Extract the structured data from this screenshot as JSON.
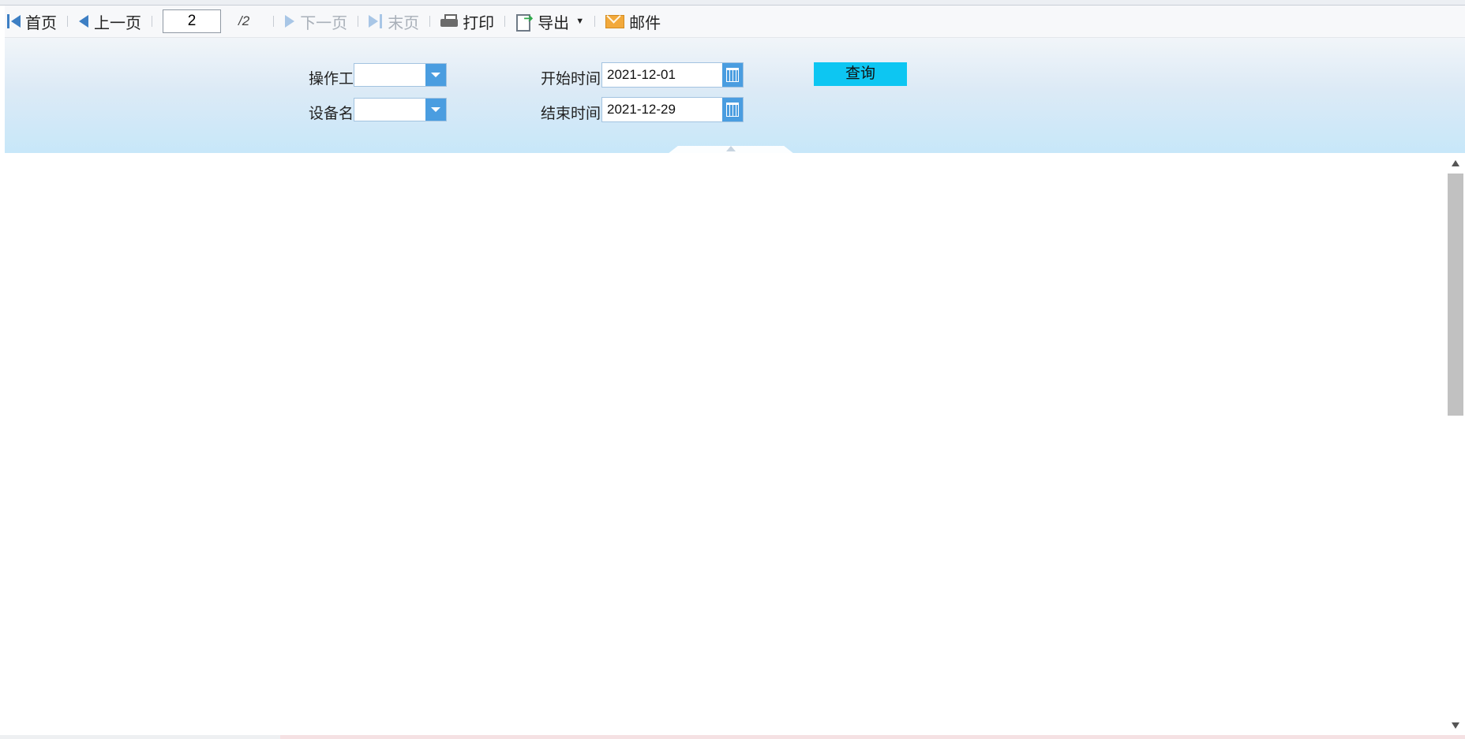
{
  "toolbar": {
    "first_label": "首页",
    "prev_label": "上一页",
    "current_page": "2",
    "total_pages": "/2",
    "next_label": "下一页",
    "last_label": "末页",
    "print_label": "打印",
    "export_label": "导出",
    "mail_label": "邮件"
  },
  "params": {
    "operator_label": "操作工:",
    "operator_value": "",
    "device_label": "设备名:",
    "device_value": "",
    "start_label": "开始时间:",
    "start_value": "2021-12-01",
    "end_label": "结束时间:",
    "end_value": "2021-12-29",
    "query_label": "查询"
  },
  "colors": {
    "accent": "#4a9de0",
    "query_button": "#0dc6f2"
  },
  "icons": [
    "first-page-icon",
    "prev-page-icon",
    "next-page-icon",
    "last-page-icon",
    "print-icon",
    "export-icon",
    "mail-icon",
    "dropdown-arrow-icon",
    "calendar-icon"
  ]
}
